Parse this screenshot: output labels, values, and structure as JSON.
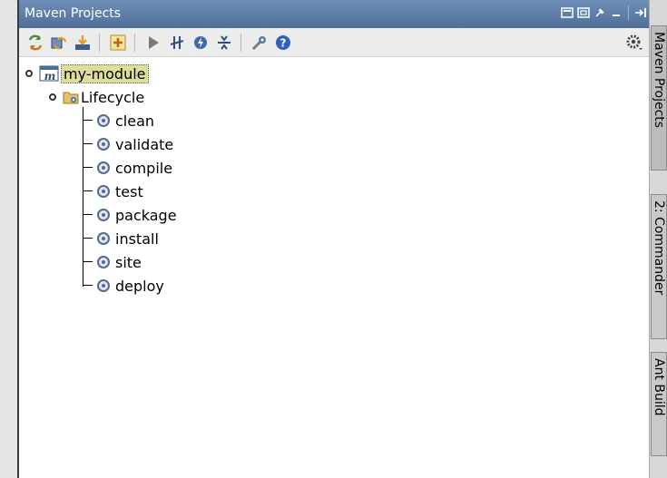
{
  "panel": {
    "title": "Maven Projects"
  },
  "toolbar": {
    "icons": [
      "reimport-icon",
      "generate-sources-icon",
      "download-icon",
      "add-maven-project-icon",
      "run-icon",
      "toggle-offline-icon",
      "execute-goal-icon",
      "collapse-all-icon",
      "settings-icon",
      "help-icon"
    ],
    "right_icon": "gear-icon"
  },
  "tree": {
    "module": "my-module",
    "lifecycle": "Lifecycle",
    "goals": [
      "clean",
      "validate",
      "compile",
      "test",
      "package",
      "install",
      "site",
      "deploy"
    ]
  },
  "right_tabs": [
    {
      "label": "Maven Projects"
    },
    {
      "label": "2: Commander"
    },
    {
      "label": "Ant Build"
    }
  ],
  "colors": {
    "title_bar": "#5677a3",
    "selection": "#dede9a",
    "toolbar_bg": "#ececec"
  }
}
